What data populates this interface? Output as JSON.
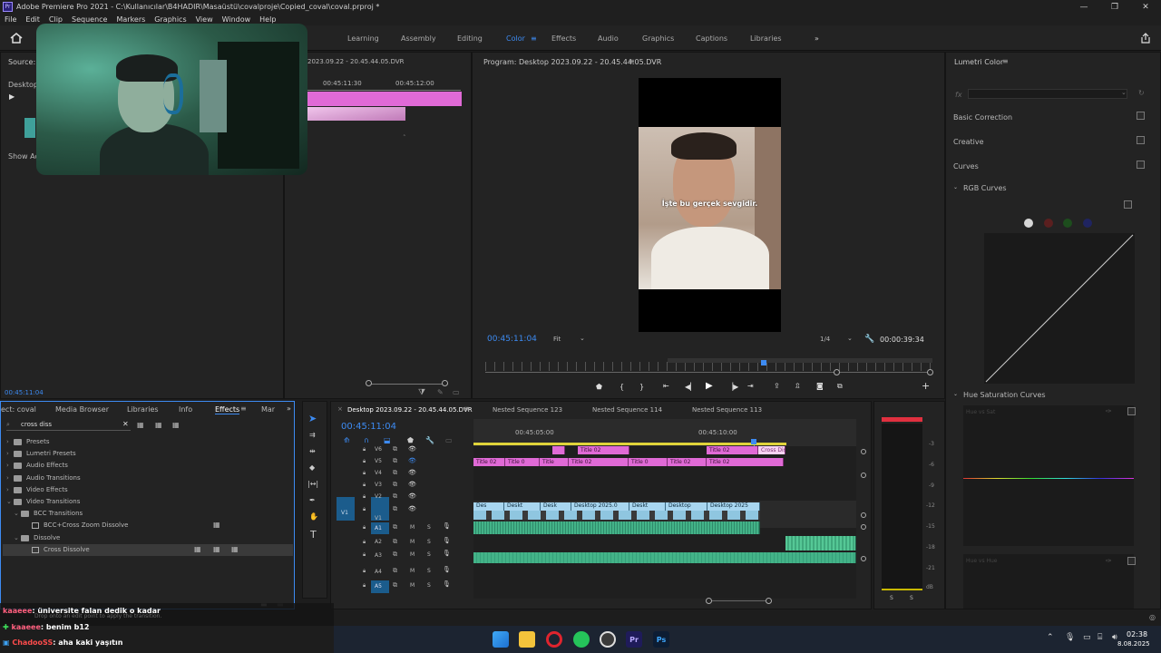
{
  "window": {
    "title": "Adobe Premiere Pro 2021 - C:\\Kullanıcılar\\B4HADIR\\Masaüstü\\covalproje\\Copied_coval\\coval.prproj *",
    "app_icon": "Pr",
    "controls": [
      "—",
      "❐",
      "✕"
    ]
  },
  "menu": [
    "File",
    "Edit",
    "Clip",
    "Sequence",
    "Markers",
    "Graphics",
    "View",
    "Window",
    "Help"
  ],
  "workspaces": [
    "Learning",
    "Assembly",
    "Editing",
    "Color",
    "Effects",
    "Audio",
    "Graphics",
    "Captions",
    "Libraries"
  ],
  "workspace_active": "Color",
  "workspace_more": "»",
  "source": {
    "label_source": "Source: (n",
    "label_desktop": "Desktop 2",
    "label_show": "Show Acti",
    "seq_name": "2023.09.22 - 20.45.44.05.DVR",
    "tc1": "00:45:11:30",
    "tc2": "00:45:12:00",
    "bottom_tc": "00:45:11:04"
  },
  "program": {
    "title": "Program: Desktop 2023.09.22 - 20.45.44.05.DVR",
    "subtitle": "İşte bu gerçek sevgidir.",
    "timecode": "00:45:11:04",
    "fit": "Fit",
    "ratio": "1/4",
    "duration": "00:00:39:34"
  },
  "lumetri": {
    "title": "Lumetri Color",
    "fx": "fx",
    "sections": [
      "Basic Correction",
      "Creative",
      "Curves"
    ],
    "rgb_curves": "RGB Curves",
    "hue_sat": "Hue Saturation Curves",
    "hue_vs_sat": "Hue vs Sat",
    "hue_vs_hue": "Hue vs Hue"
  },
  "effects_panel": {
    "tabs": [
      "ect: coval",
      "Media Browser",
      "Libraries",
      "Info",
      "Effects",
      "Mar"
    ],
    "active_tab": "Effects",
    "search_value": "cross diss",
    "tree": [
      {
        "label": "Presets",
        "level": 0
      },
      {
        "label": "Lumetri Presets",
        "level": 0
      },
      {
        "label": "Audio Effects",
        "level": 0
      },
      {
        "label": "Audio Transitions",
        "level": 0
      },
      {
        "label": "Video Effects",
        "level": 0
      },
      {
        "label": "Video Transitions",
        "level": 0
      },
      {
        "label": "BCC Transitions",
        "level": 1
      },
      {
        "label": "BCC+Cross Zoom Dissolve",
        "level": 2
      },
      {
        "label": "Dissolve",
        "level": 1
      },
      {
        "label": "Cross Dissolve",
        "level": 2
      }
    ],
    "hint": "Drop onto an edit point to apply the transition."
  },
  "timeline": {
    "tabs": [
      "Desktop 2023.09.22 - 20.45.44.05.DVR",
      "Nested Sequence 123",
      "Nested Sequence 114",
      "Nested Sequence 113"
    ],
    "timecode": "00:45:11:04",
    "ruler": [
      "00:45:05:00",
      "00:45:10:00"
    ],
    "tracks": [
      {
        "name": "V6"
      },
      {
        "name": "V5"
      },
      {
        "name": "V4"
      },
      {
        "name": "V3"
      },
      {
        "name": "V2"
      },
      {
        "name": "V1",
        "src": "V1"
      },
      {
        "name": "A1",
        "src": "A1",
        "m": "M",
        "s": "S"
      },
      {
        "name": "A2",
        "m": "M",
        "s": "S"
      },
      {
        "name": "A3",
        "m": "M",
        "s": "S"
      },
      {
        "name": "A4",
        "m": "M",
        "s": "S"
      },
      {
        "name": "A5",
        "m": "M",
        "s": "S"
      }
    ],
    "clips_v6": [
      "Title 02",
      "Title 02",
      "Cross Diss"
    ],
    "clips_v5": [
      "Title 02",
      "Title 0",
      "Title",
      "Title 02",
      "Title 0",
      "Title 02",
      "Title 02"
    ],
    "clips_v1": [
      "Des",
      "Deskt",
      "Desk",
      "Desktop 2025.0",
      "Deskt",
      "Desktop",
      "Desktop 2025"
    ]
  },
  "meter_scale": [
    "-3",
    "-6",
    "-9",
    "-12",
    "-15",
    "-18",
    "-21",
    "dB"
  ],
  "meter_solo": [
    "S",
    "S"
  ],
  "chat": [
    {
      "user": "kaaeee",
      "text": ": üniversite falan dedik o kadar"
    },
    {
      "user": "kaaeee",
      "text": ": benim b12"
    },
    {
      "user": "ChadooSS",
      "text": ": aha kaki yaşıtın"
    }
  ],
  "taskbar": {
    "clock_time": "02:38",
    "clock_date": "8.08.2025",
    "apps": [
      "windows-icon",
      "explorer-icon",
      "opera-icon",
      "whatsapp-icon",
      "obs-icon",
      "premiere-icon",
      "photoshop-icon"
    ],
    "premiere_label": "Pr",
    "photoshop_label": "Ps"
  },
  "colors": {
    "accent": "#3d8bf2",
    "title_clip": "#e06ad6",
    "video_clip": "#a8d6f0",
    "audio_clip": "#43b388"
  }
}
